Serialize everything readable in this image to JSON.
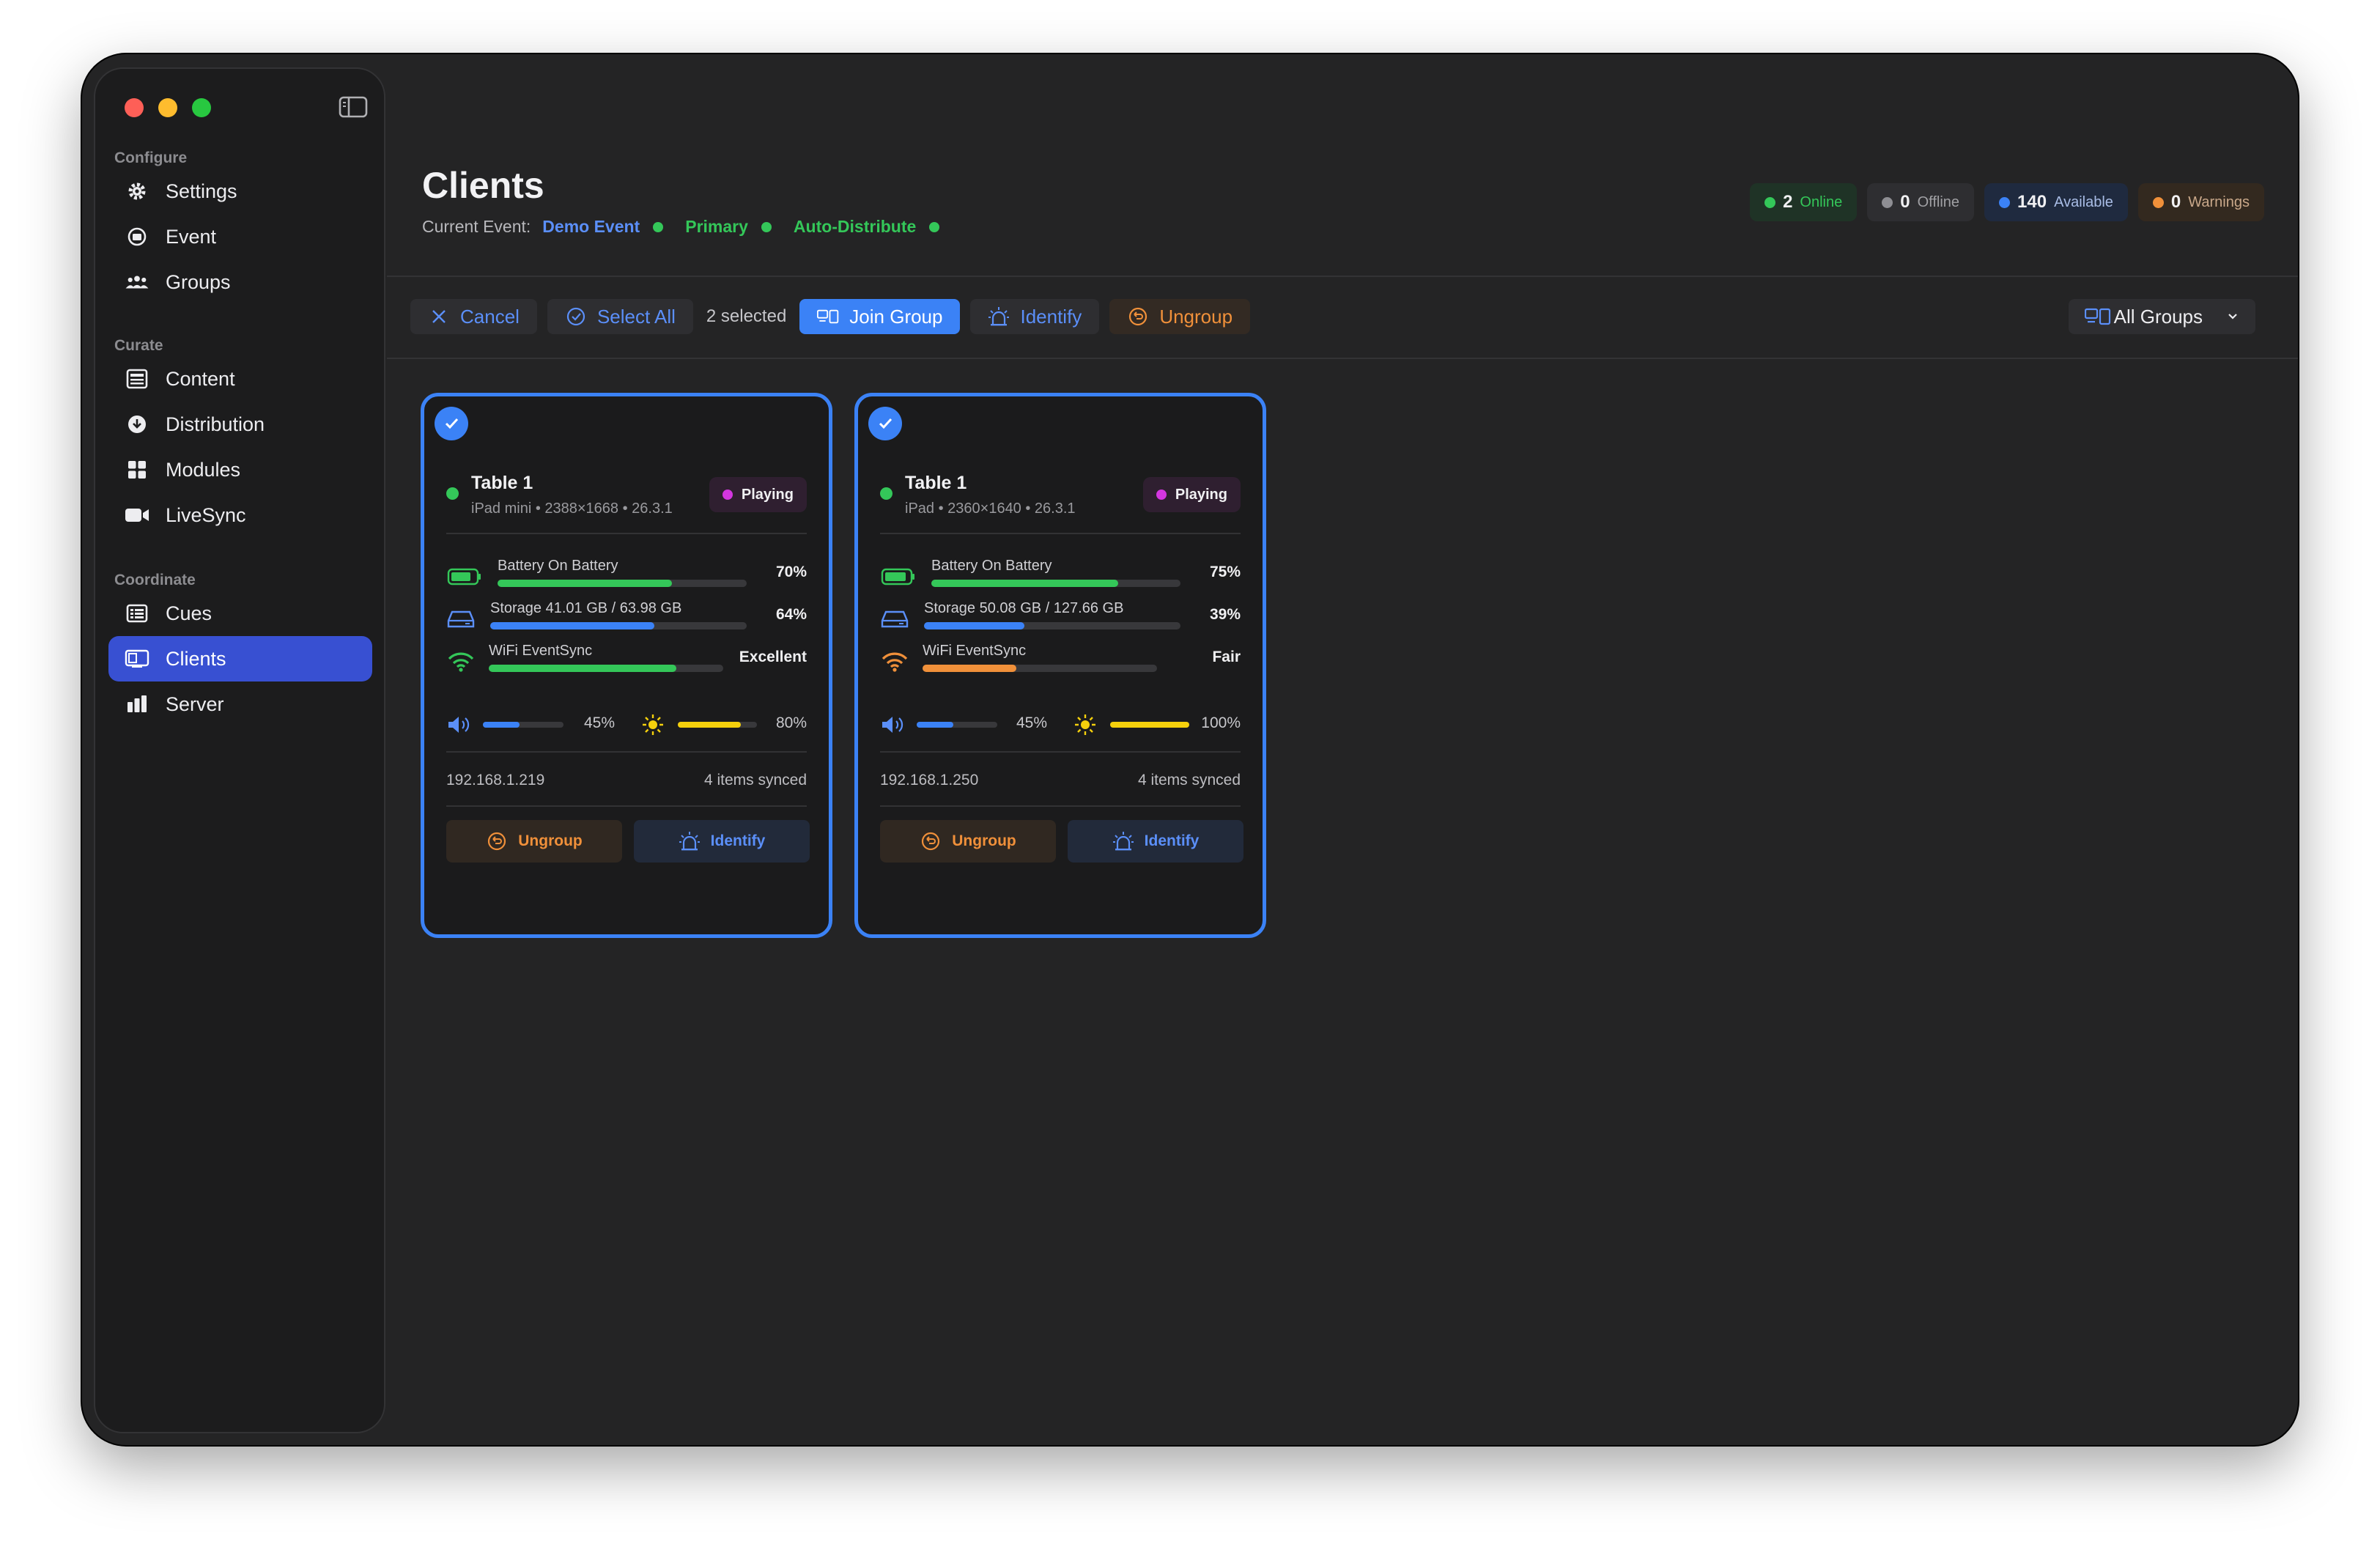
{
  "sidebar": {
    "sections": [
      {
        "label": "Configure"
      },
      {
        "label": "Curate"
      },
      {
        "label": "Coordinate"
      }
    ],
    "items": [
      {
        "label": "Settings",
        "icon": "gear-icon"
      },
      {
        "label": "Event",
        "icon": "calendar-icon"
      },
      {
        "label": "Groups",
        "icon": "people-icon"
      },
      {
        "label": "Content",
        "icon": "content-icon"
      },
      {
        "label": "Distribution",
        "icon": "download-circle-icon"
      },
      {
        "label": "Modules",
        "icon": "grid-icon"
      },
      {
        "label": "LiveSync",
        "icon": "video-camera-icon"
      },
      {
        "label": "Cues",
        "icon": "list-icon"
      },
      {
        "label": "Clients",
        "icon": "display-icon",
        "active": true
      },
      {
        "label": "Server",
        "icon": "bar-chart-icon"
      }
    ]
  },
  "header": {
    "title": "Clients",
    "current_event_label": "Current Event:",
    "event_name": "Demo Event",
    "primary": "Primary",
    "auto_distribute": "Auto-Distribute"
  },
  "badges": [
    {
      "count": "2",
      "label": "Online",
      "color": "#34c759"
    },
    {
      "count": "0",
      "label": "Offline",
      "color": "#8e8e93"
    },
    {
      "count": "140",
      "label": "Available",
      "color": "#3b82f6"
    },
    {
      "count": "0",
      "label": "Warnings",
      "color": "#f0903a"
    }
  ],
  "toolbar": {
    "cancel": "Cancel",
    "select_all": "Select All",
    "selected_count": "2 selected",
    "join_group": "Join Group",
    "identify": "Identify",
    "ungroup": "Ungroup",
    "group_filter": "All Groups"
  },
  "clients": [
    {
      "name": "Table 1",
      "device": "iPad mini • 2388×1668 • 26.3.1",
      "status": "Playing",
      "selected": true,
      "battery_label": "Battery  On Battery",
      "battery_value": "70%",
      "battery_level": 0.7,
      "storage_label": "Storage  41.01 GB / 63.98 GB",
      "storage_value": "64%",
      "storage_level": 0.64,
      "wifi_label": "WiFi  EventSync",
      "wifi_value": "Excellent",
      "wifi_level": 0.8,
      "wifi_color": "#34c759",
      "volume": "45%",
      "volume_level": 0.45,
      "brightness": "80%",
      "brightness_level": 0.8,
      "ip": "192.168.1.219",
      "synced": "4 items synced",
      "ungroup": "Ungroup",
      "identify": "Identify"
    },
    {
      "name": "Table 1",
      "device": "iPad • 2360×1640 • 26.3.1",
      "status": "Playing",
      "selected": true,
      "battery_label": "Battery  On Battery",
      "battery_value": "75%",
      "battery_level": 0.75,
      "storage_label": "Storage  50.08 GB / 127.66 GB",
      "storage_value": "39%",
      "storage_level": 0.39,
      "wifi_label": "WiFi  EventSync",
      "wifi_value": "Fair",
      "wifi_level": 0.4,
      "wifi_color": "#f0903a",
      "volume": "45%",
      "volume_level": 0.45,
      "brightness": "100%",
      "brightness_level": 1.0,
      "ip": "192.168.1.250",
      "synced": "4 items synced",
      "ungroup": "Ungroup",
      "identify": "Identify"
    }
  ]
}
